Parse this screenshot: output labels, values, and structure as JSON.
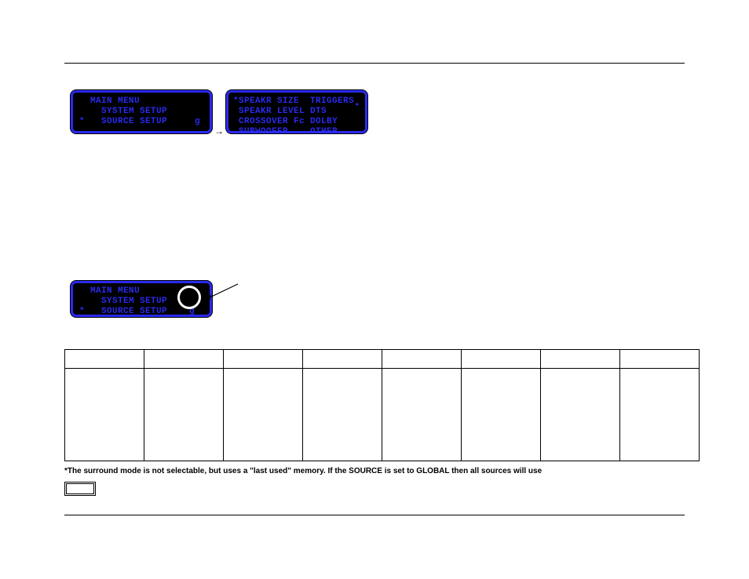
{
  "screen1": {
    "line1": "  MAIN MENU",
    "line2": "    SYSTEM SETUP",
    "line3": "*   SOURCE SETUP     g"
  },
  "arrow_between": "→",
  "screen2": {
    "line1": "*SPEAKR SIZE  TRIGGERS",
    "line2": " SPEAKR LEVEL DTS",
    "line3": " CROSSOVER Fc DOLBY",
    "line4": " SUBWOOFER    OTHER",
    "dot": "•"
  },
  "screen3": {
    "line1": "  MAIN MENU",
    "line2": "    SYSTEM SETUP",
    "line3": "*   SOURCE SETUP    g"
  },
  "footnote": "*The surround mode is not selectable, but uses a \"last used\" memory. If the SOURCE is set to GLOBAL then all sources will use"
}
